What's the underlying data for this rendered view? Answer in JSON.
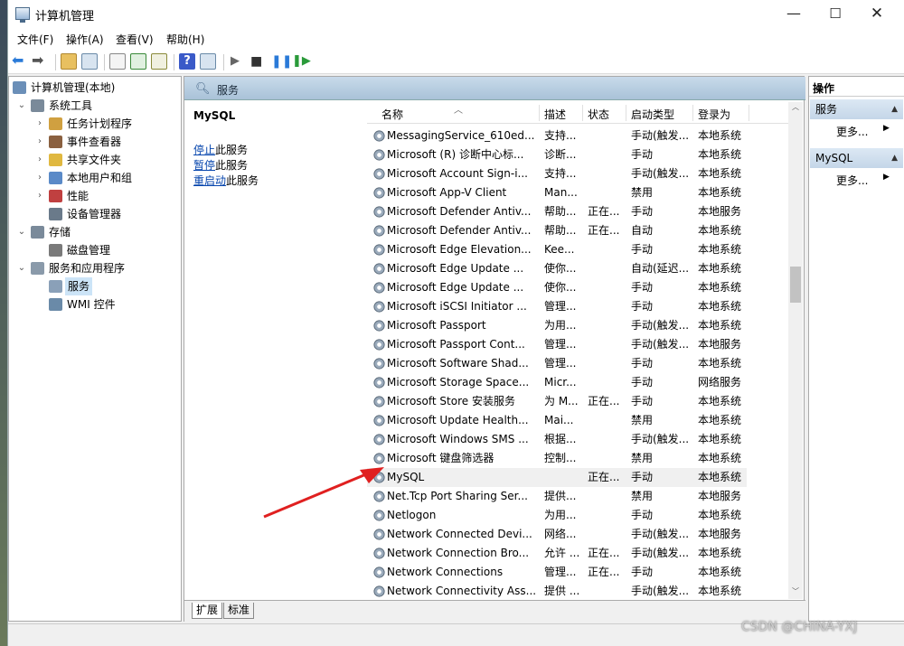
{
  "window": {
    "title": "计算机管理"
  },
  "menu": [
    "文件(F)",
    "操作(A)",
    "查看(V)",
    "帮助(H)"
  ],
  "tree": [
    {
      "label": "计算机管理(本地)",
      "indent": 0,
      "exp": "",
      "icon": "computer-icon",
      "color": "#6b8fb8"
    },
    {
      "label": "系统工具",
      "indent": 1,
      "exp": "⌄",
      "icon": "tools-icon",
      "color": "#7a8a9a"
    },
    {
      "label": "任务计划程序",
      "indent": 2,
      "exp": "›",
      "icon": "clock-icon",
      "color": "#d0a040"
    },
    {
      "label": "事件查看器",
      "indent": 2,
      "exp": "›",
      "icon": "event-viewer-icon",
      "color": "#8a6040"
    },
    {
      "label": "共享文件夹",
      "indent": 2,
      "exp": "›",
      "icon": "shared-folder-icon",
      "color": "#e0b840"
    },
    {
      "label": "本地用户和组",
      "indent": 2,
      "exp": "›",
      "icon": "users-icon",
      "color": "#5a8ac8"
    },
    {
      "label": "性能",
      "indent": 2,
      "exp": "›",
      "icon": "performance-icon",
      "color": "#c04040"
    },
    {
      "label": "设备管理器",
      "indent": 2,
      "exp": "",
      "icon": "device-manager-icon",
      "color": "#6a7a8a"
    },
    {
      "label": "存储",
      "indent": 1,
      "exp": "⌄",
      "icon": "storage-icon",
      "color": "#7a8a9a"
    },
    {
      "label": "磁盘管理",
      "indent": 2,
      "exp": "",
      "icon": "disk-icon",
      "color": "#7a7a7a"
    },
    {
      "label": "服务和应用程序",
      "indent": 1,
      "exp": "⌄",
      "icon": "services-apps-icon",
      "color": "#8a9aaa"
    },
    {
      "label": "服务",
      "indent": 2,
      "exp": "",
      "icon": "services-icon",
      "color": "#8aa0b8",
      "selected": true
    },
    {
      "label": "WMI 控件",
      "indent": 2,
      "exp": "",
      "icon": "wmi-icon",
      "color": "#6a8aa8"
    }
  ],
  "center": {
    "header": "服务",
    "selected_service": "MySQL",
    "actions": [
      {
        "link": "停止",
        "rest": "此服务"
      },
      {
        "link": "暂停",
        "rest": "此服务"
      },
      {
        "link": "重启动",
        "rest": "此服务"
      }
    ],
    "columns": [
      "名称",
      "描述",
      "状态",
      "启动类型",
      "登录为"
    ],
    "rows": [
      [
        "MessagingService_610ed...",
        "支持...",
        "",
        "手动(触发...",
        "本地系统"
      ],
      [
        "Microsoft (R) 诊断中心标...",
        "诊断...",
        "",
        "手动",
        "本地系统"
      ],
      [
        "Microsoft Account Sign-i...",
        "支持...",
        "",
        "手动(触发...",
        "本地系统"
      ],
      [
        "Microsoft App-V Client",
        "Man...",
        "",
        "禁用",
        "本地系统"
      ],
      [
        "Microsoft Defender Antiv...",
        "帮助...",
        "正在...",
        "手动",
        "本地服务"
      ],
      [
        "Microsoft Defender Antiv...",
        "帮助...",
        "正在...",
        "自动",
        "本地系统"
      ],
      [
        "Microsoft Edge Elevation...",
        "Kee...",
        "",
        "手动",
        "本地系统"
      ],
      [
        "Microsoft Edge Update ...",
        "使你...",
        "",
        "自动(延迟...",
        "本地系统"
      ],
      [
        "Microsoft Edge Update ...",
        "使你...",
        "",
        "手动",
        "本地系统"
      ],
      [
        "Microsoft iSCSI Initiator ...",
        "管理...",
        "",
        "手动",
        "本地系统"
      ],
      [
        "Microsoft Passport",
        "为用...",
        "",
        "手动(触发...",
        "本地系统"
      ],
      [
        "Microsoft Passport Cont...",
        "管理...",
        "",
        "手动(触发...",
        "本地服务"
      ],
      [
        "Microsoft Software Shad...",
        "管理...",
        "",
        "手动",
        "本地系统"
      ],
      [
        "Microsoft Storage Space...",
        "Micr...",
        "",
        "手动",
        "网络服务"
      ],
      [
        "Microsoft Store 安装服务",
        "为 M...",
        "正在...",
        "手动",
        "本地系统"
      ],
      [
        "Microsoft Update Health...",
        "Mai...",
        "",
        "禁用",
        "本地系统"
      ],
      [
        "Microsoft Windows SMS ...",
        "根据...",
        "",
        "手动(触发...",
        "本地系统"
      ],
      [
        "Microsoft 键盘筛选器",
        "控制...",
        "",
        "禁用",
        "本地系统"
      ],
      [
        "MySQL",
        "",
        "正在...",
        "手动",
        "本地系统"
      ],
      [
        "Net.Tcp Port Sharing Ser...",
        "提供...",
        "",
        "禁用",
        "本地服务"
      ],
      [
        "Netlogon",
        "为用...",
        "",
        "手动",
        "本地系统"
      ],
      [
        "Network Connected Devi...",
        "网络...",
        "",
        "手动(触发...",
        "本地服务"
      ],
      [
        "Network Connection Bro...",
        "允许 ...",
        "正在...",
        "手动(触发...",
        "本地系统"
      ],
      [
        "Network Connections",
        "管理...",
        "正在...",
        "手动",
        "本地系统"
      ],
      [
        "Network Connectivity Ass...",
        "提供 ...",
        "",
        "手动(触发...",
        "本地系统"
      ]
    ],
    "tabs": [
      "扩展",
      "标准"
    ]
  },
  "actions_pane": {
    "header": "操作",
    "sections": [
      {
        "title": "服务",
        "more": "更多..."
      },
      {
        "title": "MySQL",
        "more": "更多..."
      }
    ]
  },
  "watermark": "CSDN @CHINA-YXJ"
}
